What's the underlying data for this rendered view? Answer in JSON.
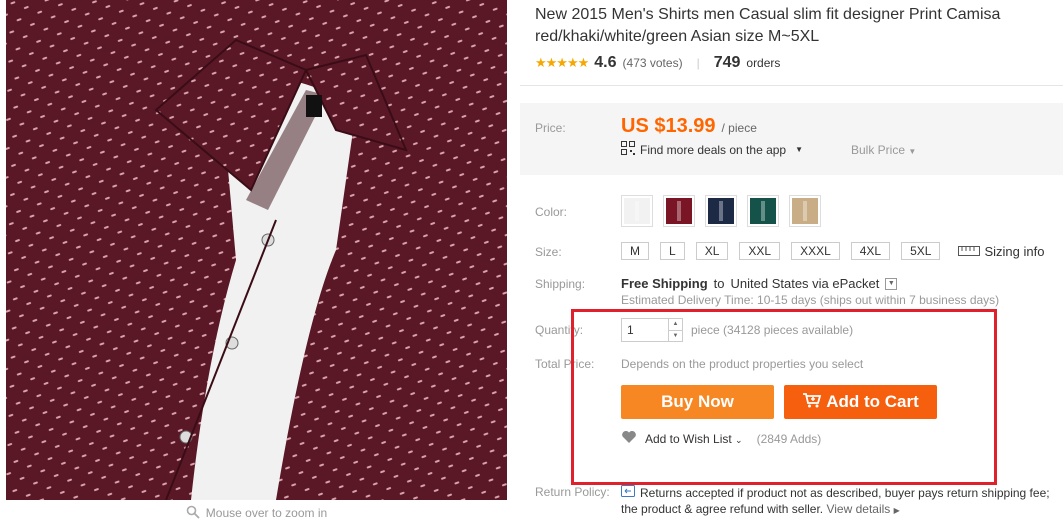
{
  "gallery": {
    "zoom_hint": "Mouse over to zoom in"
  },
  "product": {
    "title_line1": "New 2015 Men's Shirts men Casual slim fit designer Print Camisa",
    "title_line2": "red/khaki/white/green Asian size M~5XL",
    "rating": "4.6",
    "votes": "(473 votes)",
    "orders_count": "749",
    "orders_label": "orders"
  },
  "price": {
    "label": "Price:",
    "value": "US $13.99",
    "unit": "/ piece",
    "app_deals": "Find more deals on the app",
    "bulk": "Bulk Price"
  },
  "color": {
    "label": "Color:",
    "swatches": [
      "#f2f2f2",
      "#7a1525",
      "#1d2a45",
      "#15524a",
      "#c8ad86"
    ]
  },
  "size": {
    "label": "Size:",
    "options": [
      "M",
      "L",
      "XL",
      "XXL",
      "XXXL",
      "4XL",
      "5XL"
    ],
    "sizing_info": "Sizing info"
  },
  "shipping": {
    "label": "Shipping:",
    "free": "Free Shipping",
    "to": "to",
    "destination": "United States via ePacket",
    "delivery": "Estimated Delivery Time: 10-15 days (ships out within 7 business days)"
  },
  "quantity": {
    "label": "Quantity:",
    "value": "1",
    "available": "piece (34128 pieces available)"
  },
  "total": {
    "label": "Total Price:",
    "value": "Depends on the product properties you select"
  },
  "actions": {
    "buy_now": "Buy Now",
    "add_to_cart": "Add to Cart",
    "wishlist": "Add to Wish List",
    "wishlist_adds": "(2849 Adds)"
  },
  "returns": {
    "label": "Return Policy:",
    "line1": "Returns accepted if product not as described, buyer pays return shipping fee;",
    "line2": "the product & agree refund with seller.",
    "link": "View details"
  },
  "colors": {
    "accent": "#f60",
    "buy_button": "#f78723",
    "cart_button": "#f55f0e",
    "highlight_border": "#e0202a",
    "shirt": "#4e1420"
  }
}
